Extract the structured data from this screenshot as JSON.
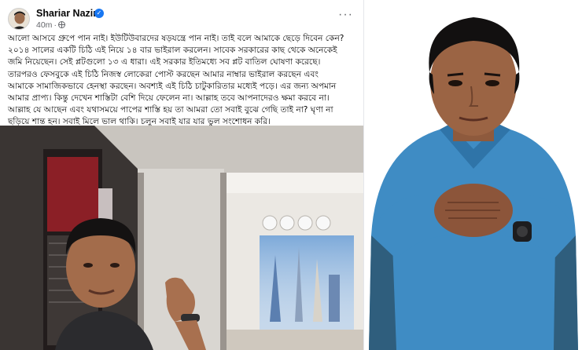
{
  "post": {
    "author_name": "Shariar Nazim",
    "verified_icon": "verified-badge-icon",
    "timestamp": "40m",
    "privacy_icon": "globe-icon",
    "more_label": "···",
    "text_lines": [
      "আলো আসবে গ্রুপে পান নাই। ইউটিউবারদের ষড়যন্ত্রে পান নাই। তাই বলে আমাকে ছেড়ে দিবেন কেন?",
      "২০১৪ সালের একটি চিঠি এই নিয়ে ১৪ বার ভাইরাল করলেন। সাবেক সরকারের কাছ থেকে অনেকেই",
      "জমি নিয়েছেন। সেই প্লটগুলো ১৩ এ ধারা। এই সরকার ইতিমধ্যে সব প্লট বাতিল ঘোষণা করেছে।",
      "তারপরও ফেসবুকে এই চিঠি নিজস্ব লোকেরা পোস্ট করছেন আমার নাম্বার ভাইরাল করছেন এবং",
      "আমাকে সামাজিকভাবে হেনস্থা করছেন। অবশ্যই এই চিঠি চাটুকারিতার মধ্যেই পড়ে। এর জন্য অপমান",
      "আমার প্রাপ্য। কিন্তু দেখেন শাস্তিটা বেশি দিয়ে ফেলেন না। আল্লাহ তবে আপনাদেরও ক্ষমা করবে না।",
      "আল্লাহ যে আছেন এবং যথাসময়ে পাপের শাস্তি হয় তা আমরা তো সবাই বুঝে গেছি তাই না? ঘৃণা না",
      "ছড়িয়ে শান্ত হন। সবাই মিলে ভাল থাকি। চলুন সবাই যার যার ভুল সংশোধন করি।"
    ]
  },
  "colors": {
    "facebook_blue": "#1877f2",
    "text_primary": "#050505",
    "text_secondary": "#65676b",
    "shirt_blue": "#3f8cc4"
  }
}
